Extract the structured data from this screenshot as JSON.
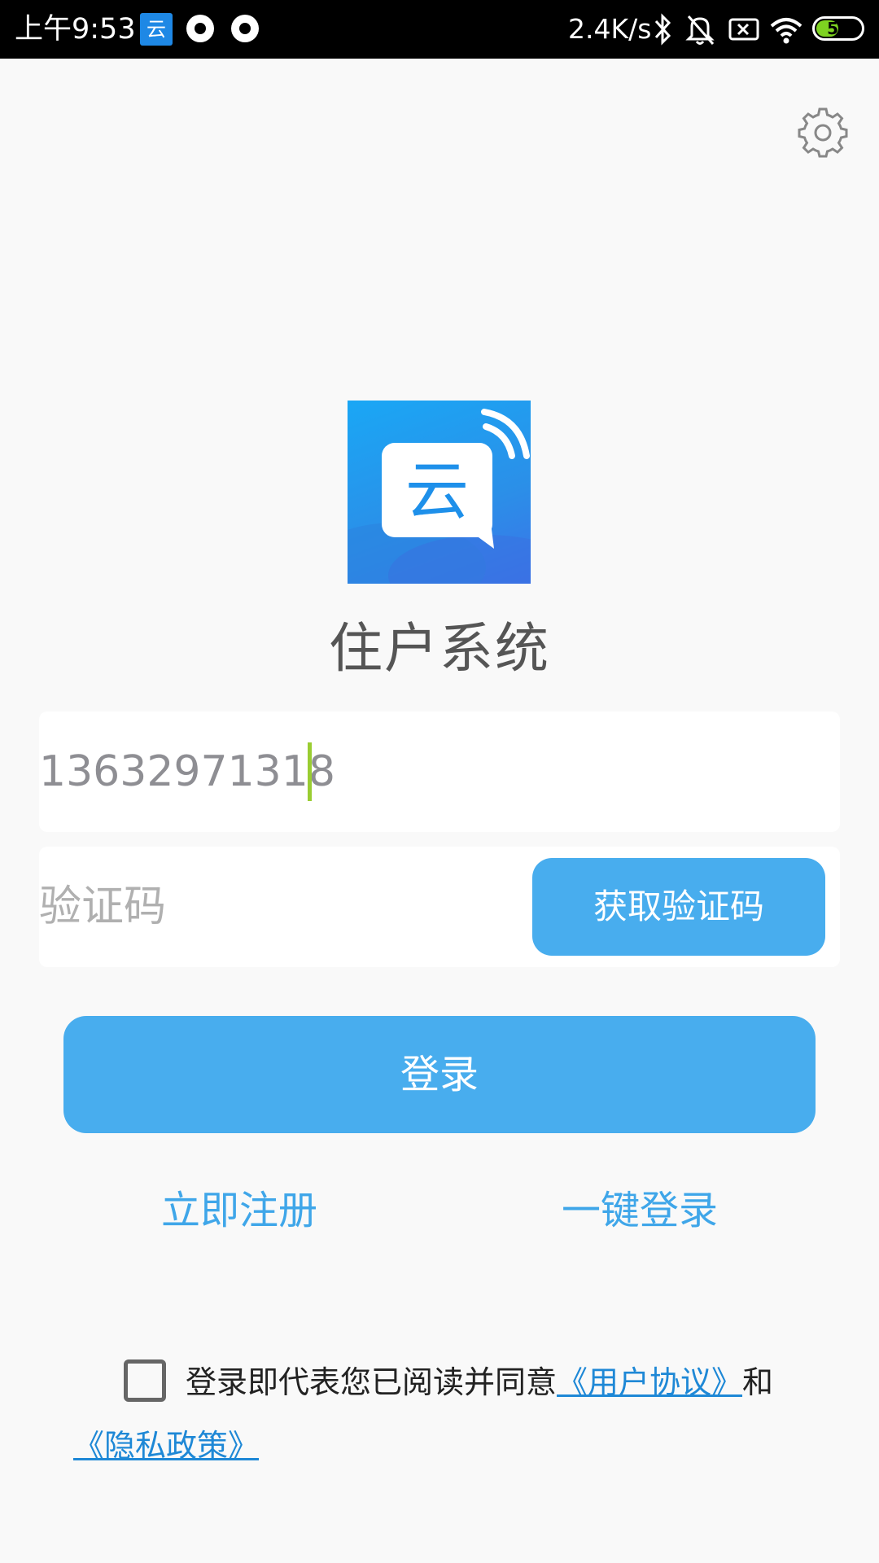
{
  "status_bar": {
    "time": "上午9:53",
    "app_icon_char": "云",
    "network_speed": "2.4K/s",
    "battery_level": "50",
    "battery_fraction": 0.5,
    "battery_color": "#7ed321",
    "icons": [
      "app-notification-icon",
      "record-icon",
      "record-icon",
      "bluetooth-icon",
      "bell-muted-icon",
      "sim-blocked-icon",
      "wifi-icon",
      "battery-icon"
    ]
  },
  "header": {
    "settings_icon": "gear-icon"
  },
  "logo": {
    "char": "云",
    "icon": "cloud-chat-logo-icon"
  },
  "app_title": "住户系统",
  "phone_field": {
    "value": "13632971318",
    "placeholder": ""
  },
  "code_field": {
    "value": "",
    "placeholder": "验证码",
    "get_code_label": "获取验证码"
  },
  "login_button_label": "登录",
  "links": {
    "register": "立即注册",
    "quick_login": "一键登录"
  },
  "agreement": {
    "checked": false,
    "text_prefix": "登录即代表您已阅读并同意",
    "user_agreement": "《用户协议》",
    "conjunction": "和",
    "privacy_policy": "《隐私政策》"
  },
  "colors": {
    "accent": "#48adee",
    "link": "#3fa6e9",
    "agreement_link": "#1e88d6",
    "background": "#f9f9f9"
  }
}
